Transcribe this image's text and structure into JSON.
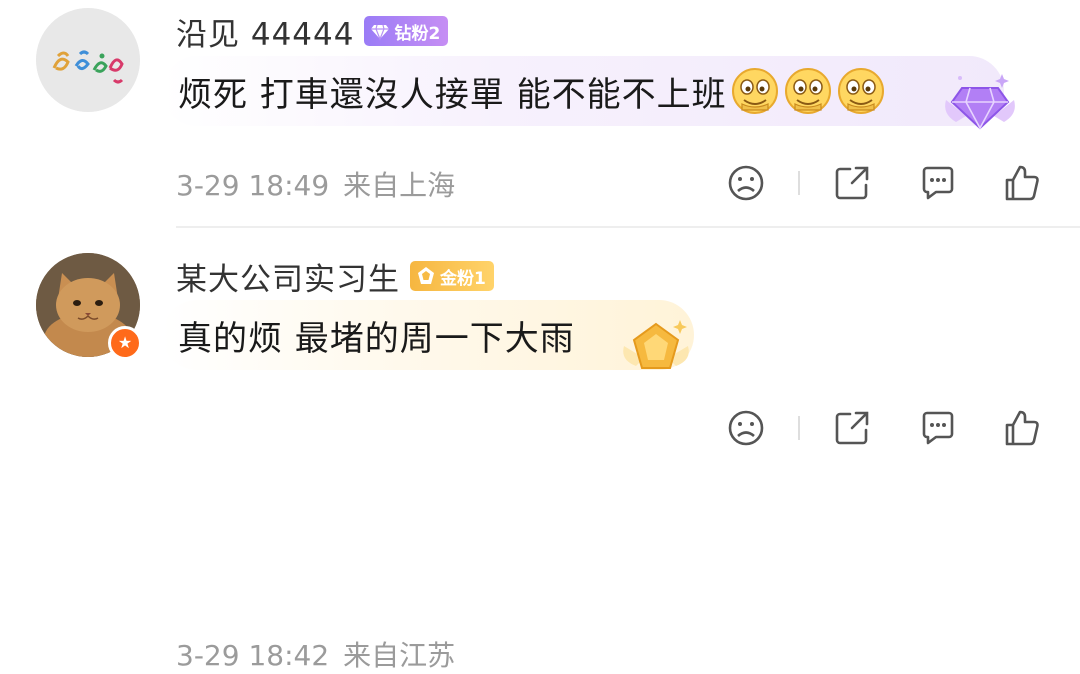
{
  "comments": [
    {
      "username": "沿见 44444",
      "fan_badge": {
        "label": "钻粉2",
        "type": "diamond",
        "color": "#b184f5"
      },
      "text": "烦死 打車還沒人接單 能不能不上班",
      "emoji_count": 3,
      "emoji_icon": "salute-face-emoji",
      "date": "3-29 18:49",
      "location": "来自上海",
      "bubble_tint": "#f1e9fb"
    },
    {
      "username": "某大公司实习生",
      "fan_badge": {
        "label": "金粉1",
        "type": "gold",
        "color": "#f7bb45"
      },
      "text": "真的烦 最堵的周一下大雨",
      "verified": true,
      "date": "3-29 18:42",
      "location": "来自江苏",
      "bubble_tint": "#fff3d8"
    }
  ],
  "actions": [
    "dislike-icon",
    "share-icon",
    "comment-icon",
    "like-icon"
  ],
  "colors": {
    "meta": "#9b9b9b",
    "name": "#333333",
    "text": "#1a1a1a",
    "verified": "#ff6a1a"
  }
}
